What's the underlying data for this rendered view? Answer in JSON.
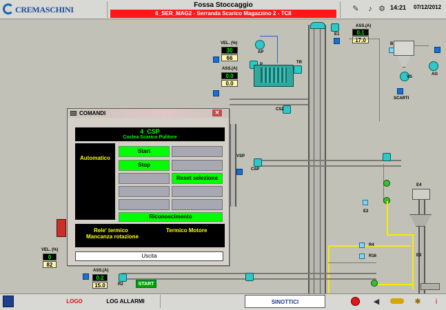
{
  "topbar": {
    "brand": "CREMASCHINI",
    "title": "Fossa Stoccaggio",
    "alarm": "6_SER_MAG2 - Serranda Scarico Magazzino 2 - TC8",
    "time": "14:21",
    "date": "07/12/2012"
  },
  "plant": {
    "vel_top": {
      "label": "VEL. (%)",
      "value": "30",
      "setpoint": "66"
    },
    "ass_top": {
      "label": "ASS.(A)",
      "value": "0.0",
      "setpoint": "0.0"
    },
    "ass_right": {
      "label": "ASS.(A)",
      "value": "0.1",
      "setpoint": "17.0"
    },
    "vel_bottom": {
      "label": "VEL. (%)",
      "value": "0",
      "setpoint": "82"
    },
    "ass_bottom": {
      "label": "ASS.(A)",
      "value": "0.2",
      "setpoint": "15.0"
    },
    "tags": {
      "ap": "AP",
      "p": "P",
      "tr": "TR",
      "cs2": "CS2",
      "e1": "E1",
      "b": "B",
      "vs": "VS",
      "ag": "AG",
      "scarti": "SCARTI",
      "vsp": "VSP",
      "csp": "CSP",
      "e2": "E2",
      "e3": "E3",
      "e4": "E4",
      "r4": "R4",
      "r16": "R16",
      "r2": "R2"
    },
    "start_label": "START"
  },
  "dialog": {
    "title": "COMANDI",
    "close": "✕",
    "device_code": "4_CSP",
    "device_name": "Coclea Scarico Pulitore",
    "mode": "Automatico",
    "start": "Start",
    "stop": "Stop",
    "reset": "Reset selezione",
    "ack": "Riconoscimento",
    "msg_thermal_relay": "Rele' termico",
    "msg_thermal_motor": "Termico Motore",
    "msg_rotation": "Mancanza rotazione",
    "exit": "Uscita"
  },
  "bottombar": {
    "logo": "LOGO",
    "log_alarms": "LOG ALLARMI",
    "synoptics": "SINOTTICI"
  },
  "colors": {
    "alarm_bar": "#ff1616",
    "active_button": "#00ff00",
    "status_text": "#ffff00",
    "motor": "#2fc8c8",
    "product_line": "#f7ec00"
  }
}
